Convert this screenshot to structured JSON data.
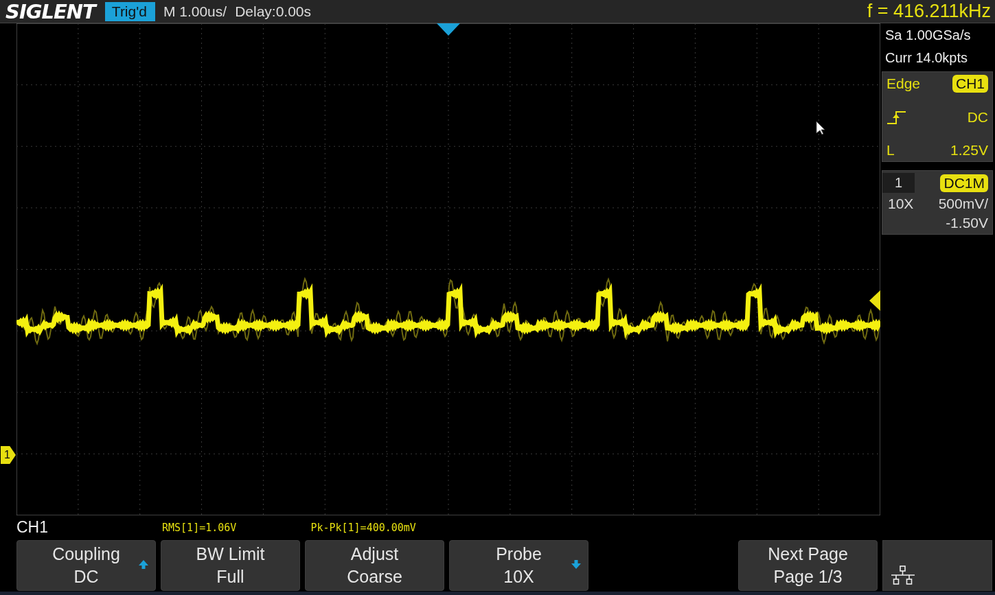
{
  "header": {
    "brand": "SIGLENT",
    "trigger_status": "Trig'd",
    "timebase": "M 1.00us/",
    "delay": "Delay:0.00s",
    "frequency": "f = 416.211kHz"
  },
  "acquisition": {
    "sample_rate": "Sa 1.00GSa/s",
    "memory_depth": "Curr 14.0kpts"
  },
  "trigger": {
    "type": "Edge",
    "source": "CH1",
    "coupling": "DC",
    "level_label": "L",
    "level_reading": "1.25V"
  },
  "channel": {
    "number": "1",
    "impedance": "DC1M",
    "probe": "10X",
    "scale": "500mV/",
    "offset": "-1.50V"
  },
  "display": {
    "channel_marker": "1"
  },
  "measurements": [
    {
      "text": "RMS[1]=1.06V"
    },
    {
      "text": "Pk-Pk[1]=400.00mV"
    }
  ],
  "menu": {
    "title": "CH1",
    "softkeys": [
      {
        "kind": "up",
        "label": "Coupling",
        "value": "DC"
      },
      {
        "kind": "plain",
        "label": "BW Limit",
        "value": "Full"
      },
      {
        "kind": "plain",
        "label": "Adjust",
        "value": "Coarse"
      },
      {
        "kind": "down",
        "label": "Probe",
        "value": "10X"
      },
      {
        "kind": "plain",
        "label": "Next Page",
        "value": "Page 1/3"
      }
    ]
  }
}
